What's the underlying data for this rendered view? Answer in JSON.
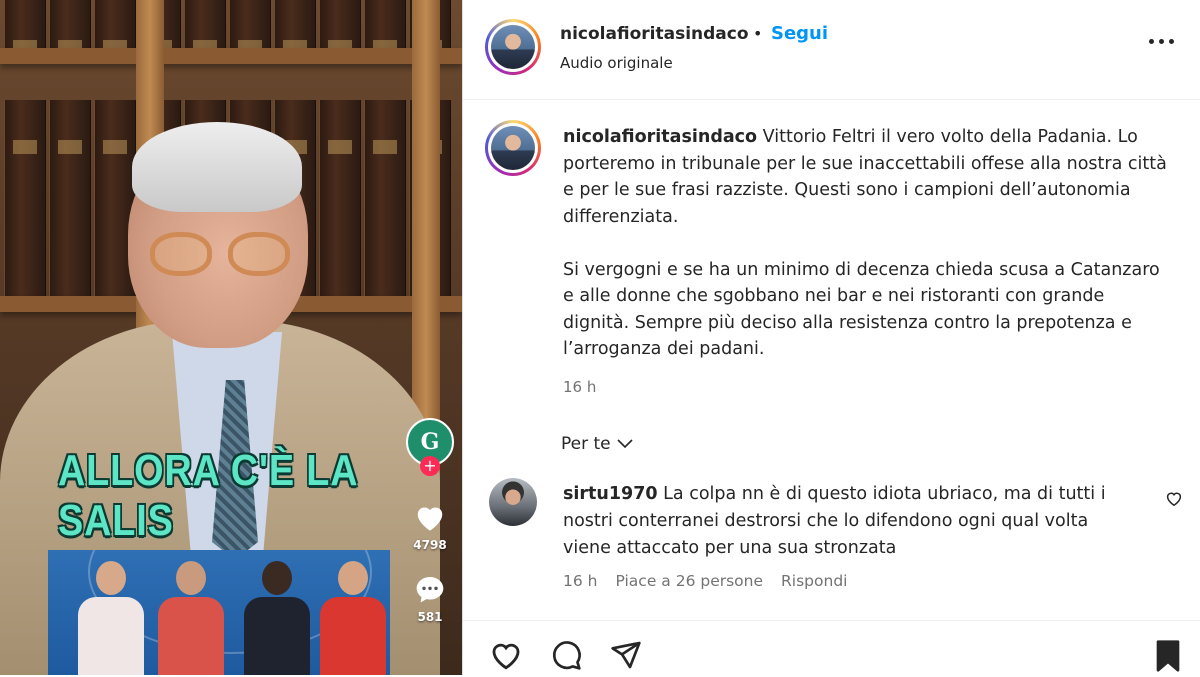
{
  "video": {
    "overlay_text": "ALLORA C'È LA SALIS",
    "creator_initial": "G",
    "plus_symbol": "+",
    "likes_count": "4798",
    "comments_count": "581"
  },
  "header": {
    "username": "nicolafioritasindaco",
    "separator": "•",
    "follow_label": "Segui",
    "audio_label": "Audio originale"
  },
  "caption": {
    "username": "nicolafioritasindaco",
    "paragraph1": "Vittorio Feltri il vero volto della Padania. Lo porteremo in tribunale per le sue inaccettabili offese alla nostra città e per le sue frasi razziste. Questi sono i campioni dell’autonomia differenziata.",
    "paragraph2": "Si vergogni e se ha un minimo di decenza chieda scusa a Catanzaro e alle donne che sgobbano nei bar e nei ristoranti con grande dignità. Sempre più deciso alla resistenza contro la prepotenza e l’arroganza dei padani.",
    "time": "16 h"
  },
  "filter": {
    "label": "Per te"
  },
  "comment": {
    "username": "sirtu1970",
    "text": "La colpa nn è di questo idiota ubriaco, ma di tutti i nostri conterranei destrorsi che lo difendono ogni qual volta viene attaccato per una sua stronzata",
    "time": "16 h",
    "likes": "Piace a 26 persone",
    "reply_label": "Rispondi"
  },
  "icons": {
    "like": "heart-icon",
    "comment": "comment-icon",
    "share": "send-icon",
    "save": "bookmark-icon",
    "more": "more-icon"
  },
  "colors": {
    "follow": "#0095f6",
    "caption_overlay": "#5ce6c6",
    "muted_text": "#737373"
  }
}
